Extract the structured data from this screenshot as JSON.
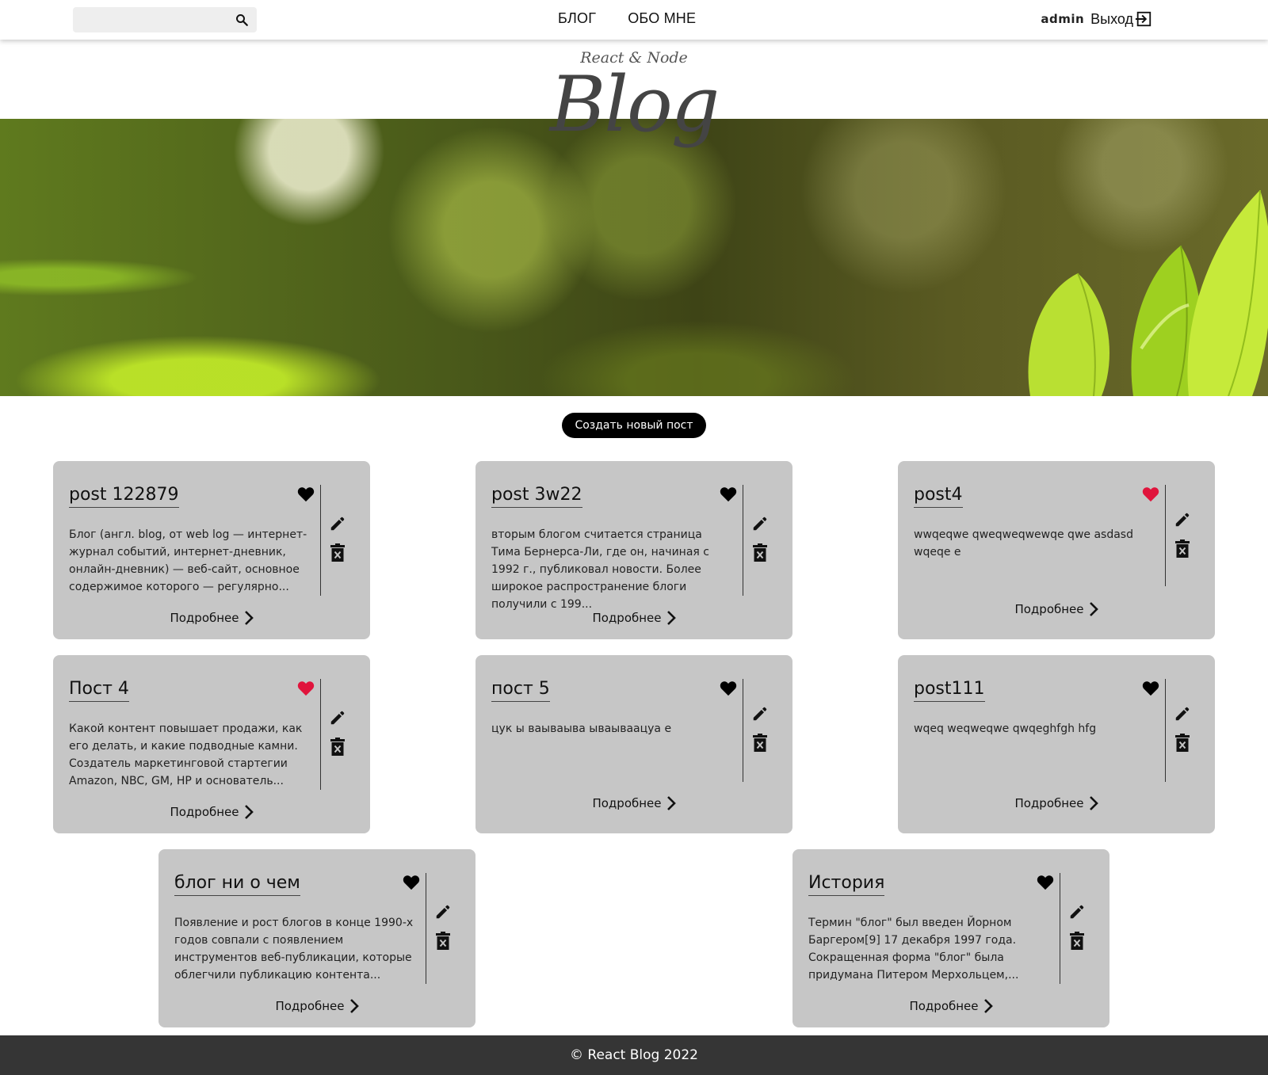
{
  "header": {
    "search": {
      "placeholder": "",
      "icon": "search-icon"
    },
    "nav": [
      {
        "label": "БЛОГ"
      },
      {
        "label": "ОБО МНЕ"
      }
    ],
    "user": {
      "name": "admin",
      "logout_label": "Выход",
      "logout_icon": "logout-icon"
    }
  },
  "hero": {
    "subtitle": "React & Node",
    "title": "Blog"
  },
  "create_button": {
    "label": "Создать новый пост"
  },
  "posts": [
    {
      "title": "post 122879",
      "liked": false,
      "text": "Блог (англ. blog, от web log — интернет-журнал событий, интернет-дневник, онлайн-дневник) — веб-сайт, основное содержимое которого — регулярно...",
      "more_label": "Подробнее"
    },
    {
      "title": "post 3w22",
      "liked": false,
      "text": "вторым блогом считается страница Тима Бернерса-Ли, где он, начиная с 1992 г., публиковал новости. Более широкое распространение блоги получили с 199...",
      "more_label": "Подробнее"
    },
    {
      "title": "post4",
      "liked": true,
      "text": "wwqeqwe qweqweqwewqe qwe asdasd wqeqe e",
      "more_label": "Подробнее"
    },
    {
      "title": "Пост 4",
      "liked": true,
      "text": "Какой контент повышает продажи, как его делать, и какие подводные камни. Создатель маркетинговой стартегии Amazon, NBC, GM, HP и основатель...",
      "more_label": "Подробнее"
    },
    {
      "title": "пост 5",
      "liked": false,
      "text": "цук ы ваываыва ываываацуа е",
      "more_label": "Подробнее"
    },
    {
      "title": "post111",
      "liked": false,
      "text": "wqeq weqweqwe qwqeghfgh hfg",
      "more_label": "Подробнее"
    },
    {
      "title": "блог ни о чем",
      "liked": false,
      "text": "Появление и рост блогов в конце 1990-х годов совпали с появлением инструментов веб-публикации, которые облегчили публикацию контента...",
      "more_label": "Подробнее"
    },
    {
      "title": "История",
      "liked": false,
      "text": "Термин \"блог\" был введен Йорном Баргером[9] 17 декабря 1997 года. Сокращенная форма \"блог\" была придумана Питером Мерхольцем,...",
      "more_label": "Подробнее"
    }
  ],
  "colors": {
    "card_bg": "#c6c6c6",
    "heart_liked": "#e0143c",
    "heart_default": "#000000",
    "footer_bg": "#353535",
    "button_bg": "#000000"
  },
  "footer": {
    "text": "© React Blog 2022"
  }
}
